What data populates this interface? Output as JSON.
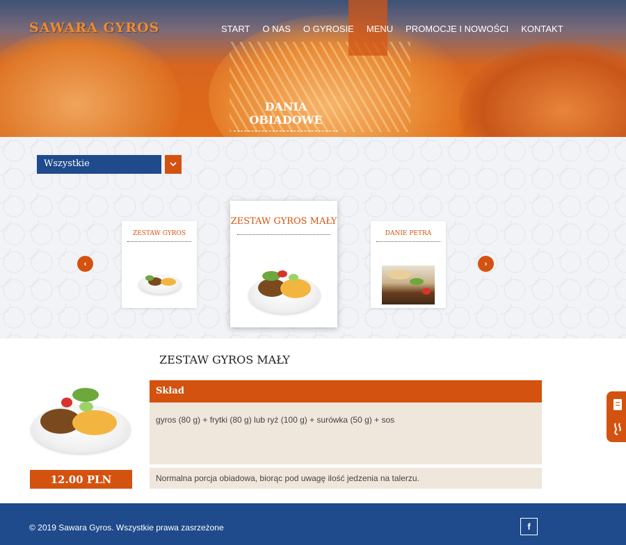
{
  "brand": {
    "logo": "SAWARA GYROS"
  },
  "nav": {
    "items": [
      "START",
      "O NAS",
      "O GYROSIE",
      "MENU",
      "PROMOCJE I NOWOŚCI",
      "KONTAKT"
    ],
    "active": "MENU"
  },
  "hero": {
    "title": "DANIA OBIADOWE"
  },
  "filter": {
    "selected": "Wszystkie"
  },
  "carousel": {
    "prev_icon": "chevron-left-icon",
    "next_icon": "chevron-right-icon",
    "items": [
      {
        "title": "ZESTAW GYROS"
      },
      {
        "title": "ZESTAW GYROS MAŁY"
      },
      {
        "title": "DANIE PETRA"
      }
    ]
  },
  "detail": {
    "title": "ZESTAW GYROS MAŁY",
    "price": "12.00 PLN",
    "ingredients_heading": "Skład",
    "ingredients": "gyros (80 g) + frytki (80 g) lub ryż (100 g) + surówka (50 g) + sos",
    "description": "Normalna porcja obiadowa, biorąc pod uwagę ilość jedzenia na talerzu."
  },
  "footer": {
    "copyright_prefix": "© 2019",
    "brand": "Sawara Gyros.",
    "rights": "Wszystkie prawa zasrzeżone",
    "social_icon": "facebook-icon"
  },
  "colors": {
    "accent": "#d4520f",
    "primary": "#1f4a8c",
    "panel": "#efe6dc"
  }
}
